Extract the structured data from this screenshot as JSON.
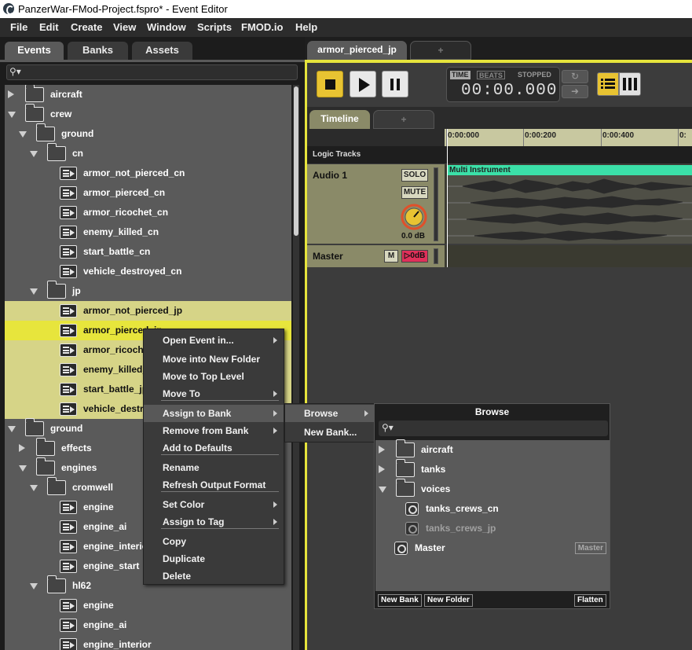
{
  "window": {
    "title": "PanzerWar-FMod-Project.fspro* - Event Editor"
  },
  "menubar": [
    "File",
    "Edit",
    "Create",
    "View",
    "Window",
    "Scripts",
    "FMOD.io",
    "Help"
  ],
  "left_tabs": [
    "Events",
    "Banks",
    "Assets"
  ],
  "search": {
    "icon": "search-icon",
    "placeholder": ""
  },
  "tree": [
    {
      "label": "aircraft",
      "type": "folder",
      "expanded": false
    },
    {
      "label": "crew",
      "type": "folder",
      "expanded": true
    },
    {
      "label": "ground",
      "type": "folder",
      "expanded": true
    },
    {
      "label": "cn",
      "type": "folder",
      "expanded": true
    },
    {
      "label": "armor_not_pierced_cn",
      "type": "event"
    },
    {
      "label": "armor_pierced_cn",
      "type": "event"
    },
    {
      "label": "armor_ricochet_cn",
      "type": "event"
    },
    {
      "label": "enemy_killed_cn",
      "type": "event"
    },
    {
      "label": "start_battle_cn",
      "type": "event"
    },
    {
      "label": "vehicle_destroyed_cn",
      "type": "event"
    },
    {
      "label": "jp",
      "type": "folder",
      "expanded": true
    },
    {
      "label": "armor_not_pierced_jp",
      "type": "event",
      "selected": true
    },
    {
      "label": "armor_pierced_jp",
      "type": "event",
      "selected": true,
      "focused": true
    },
    {
      "label": "armor_ricochet_jp",
      "type": "event",
      "selected": true
    },
    {
      "label": "enemy_killed_jp",
      "type": "event",
      "selected": true
    },
    {
      "label": "start_battle_jp",
      "type": "event",
      "selected": true
    },
    {
      "label": "vehicle_destroyed_jp",
      "type": "event",
      "selected": true
    },
    {
      "label": "ground",
      "type": "folder",
      "expanded": true
    },
    {
      "label": "effects",
      "type": "folder",
      "expanded": false
    },
    {
      "label": "engines",
      "type": "folder",
      "expanded": true
    },
    {
      "label": "cromwell",
      "type": "folder",
      "expanded": true
    },
    {
      "label": "engine",
      "type": "event"
    },
    {
      "label": "engine_ai",
      "type": "event"
    },
    {
      "label": "engine_interior",
      "type": "event"
    },
    {
      "label": "engine_start",
      "type": "event"
    },
    {
      "label": "hl62",
      "type": "folder",
      "expanded": true
    },
    {
      "label": "engine",
      "type": "event"
    },
    {
      "label": "engine_ai",
      "type": "event"
    },
    {
      "label": "engine_interior",
      "type": "event"
    }
  ],
  "editor": {
    "event_tab": "armor_pierced_jp",
    "new_tab": "+",
    "transport": {
      "time_label": "TIME",
      "beats_label": "BEATS",
      "state": "STOPPED",
      "clock": "00:00.000"
    },
    "timeline_tab": "Timeline",
    "timeline_new_tab": "+",
    "ruler_ticks": [
      "0:00:000",
      "0:00:200",
      "0:00:400",
      "0:"
    ],
    "logic_tracks": "Logic Tracks",
    "audio_track": {
      "name": "Audio 1",
      "solo": "SOLO",
      "mute": "MUTE",
      "volume": "0.0 dB",
      "instrument": "Multi Instrument"
    },
    "master_track": {
      "name": "Master",
      "mute": "M",
      "volume": "▷0dB"
    }
  },
  "context_menu": {
    "items": [
      {
        "label": "Open Event in...",
        "submenu": true
      },
      {
        "label": "Move into New Folder"
      },
      {
        "label": "Move to Top Level"
      },
      {
        "label": "Move To",
        "submenu": true
      },
      {
        "label": "Assign to Bank",
        "submenu": true,
        "highlighted": true
      },
      {
        "label": "Remove from Bank",
        "submenu": true
      },
      {
        "label": "Add to Defaults"
      },
      {
        "label": "Rename"
      },
      {
        "label": "Refresh Output Format"
      },
      {
        "label": "Set Color",
        "submenu": true
      },
      {
        "label": "Assign to Tag",
        "submenu": true
      },
      {
        "label": "Copy"
      },
      {
        "label": "Duplicate"
      },
      {
        "label": "Delete"
      }
    ]
  },
  "assign_submenu": {
    "items": [
      {
        "label": "Browse",
        "submenu": true,
        "highlighted": true
      },
      {
        "label": "New Bank..."
      }
    ]
  },
  "browse_popup": {
    "title": "Browse",
    "rows": [
      {
        "label": "aircraft",
        "type": "folder",
        "expanded": false
      },
      {
        "label": "tanks",
        "type": "folder",
        "expanded": false
      },
      {
        "label": "voices",
        "type": "folder",
        "expanded": true
      },
      {
        "label": "tanks_crews_cn",
        "type": "bank"
      },
      {
        "label": "tanks_crews_jp",
        "type": "bank",
        "dimmed": true
      },
      {
        "label": "Master",
        "type": "bank",
        "tag": "Master"
      }
    ],
    "buttons": [
      "New Bank",
      "New Folder",
      "Flatten"
    ]
  },
  "colors": {
    "selection": "#d6d487",
    "focus": "#e7e53c",
    "accent": "#e6e43c",
    "instrument": "#3be0a8"
  }
}
